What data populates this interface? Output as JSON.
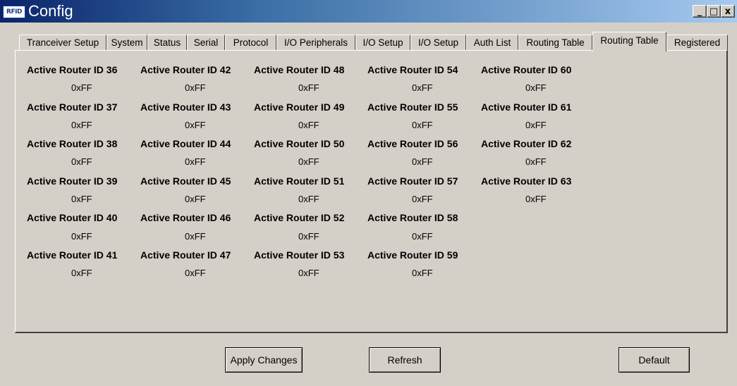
{
  "window": {
    "app_icon": "RFID",
    "title": "Config",
    "controls": {
      "minimize": "_",
      "maximize": "□",
      "close": "x"
    }
  },
  "tabs": [
    {
      "label": "Tranceiver Setup"
    },
    {
      "label": "System"
    },
    {
      "label": "Status"
    },
    {
      "label": "Serial"
    },
    {
      "label": "Protocol"
    },
    {
      "label": "I/O Peripherals"
    },
    {
      "label": "I/O Setup"
    },
    {
      "label": "I/O Setup"
    },
    {
      "label": "Auth List"
    },
    {
      "label": "Routing Table"
    },
    {
      "label": "Routing Table",
      "active": true
    },
    {
      "label": "Registered"
    }
  ],
  "routers": {
    "r36": {
      "label": "Active Router ID 36",
      "value": "0xFF"
    },
    "r37": {
      "label": "Active Router ID 37",
      "value": "0xFF"
    },
    "r38": {
      "label": "Active Router ID 38",
      "value": "0xFF"
    },
    "r39": {
      "label": "Active Router ID 39",
      "value": "0xFF"
    },
    "r40": {
      "label": "Active Router ID 40",
      "value": "0xFF"
    },
    "r41": {
      "label": "Active Router ID 41",
      "value": "0xFF"
    },
    "r42": {
      "label": "Active Router ID 42",
      "value": "0xFF"
    },
    "r43": {
      "label": "Active Router ID 43",
      "value": "0xFF"
    },
    "r44": {
      "label": "Active Router ID 44",
      "value": "0xFF"
    },
    "r45": {
      "label": "Active Router ID 45",
      "value": "0xFF"
    },
    "r46": {
      "label": "Active Router ID 46",
      "value": "0xFF"
    },
    "r47": {
      "label": "Active Router ID 47",
      "value": "0xFF"
    },
    "r48": {
      "label": "Active Router ID 48",
      "value": "0xFF"
    },
    "r49": {
      "label": "Active Router ID 49",
      "value": "0xFF"
    },
    "r50": {
      "label": "Active Router ID 50",
      "value": "0xFF"
    },
    "r51": {
      "label": "Active Router ID 51",
      "value": "0xFF"
    },
    "r52": {
      "label": "Active Router ID 52",
      "value": "0xFF"
    },
    "r53": {
      "label": "Active Router ID 53",
      "value": "0xFF"
    },
    "r54": {
      "label": "Active Router ID 54",
      "value": "0xFF"
    },
    "r55": {
      "label": "Active Router ID 55",
      "value": "0xFF"
    },
    "r56": {
      "label": "Active Router ID 56",
      "value": "0xFF"
    },
    "r57": {
      "label": "Active Router ID 57",
      "value": "0xFF"
    },
    "r58": {
      "label": "Active Router ID 58",
      "value": "0xFF"
    },
    "r59": {
      "label": "Active Router ID 59",
      "value": "0xFF"
    },
    "r60": {
      "label": "Active Router ID 60",
      "value": "0xFF"
    },
    "r61": {
      "label": "Active Router ID 61",
      "value": "0xFF"
    },
    "r62": {
      "label": "Active Router ID 62",
      "value": "0xFF"
    },
    "r63": {
      "label": "Active Router ID 63",
      "value": "0xFF"
    }
  },
  "buttons": {
    "apply": "Apply Changes",
    "refresh": "Refresh",
    "default": "Default"
  }
}
